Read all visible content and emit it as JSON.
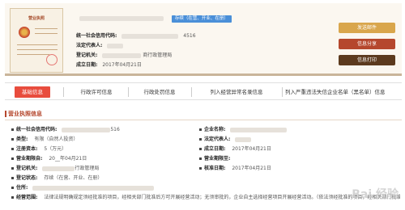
{
  "summary": {
    "cert_title": "营业执照",
    "credit_code_label": "统一社会信用代码:",
    "credit_code_value": "4516",
    "rep_label": "法定代表人:",
    "authority_label": "登记机关:",
    "authority_value": "商行政管理局",
    "established_label": "成立日期:",
    "established_value": "2017年04月21日",
    "status_badge": "存续（在营、开业、在册）",
    "actions": [
      "发送邮件",
      "信息分享",
      "信息打印"
    ]
  },
  "colors": {
    "accent_tab": "#e84c3d",
    "badge": "#4a8fd8",
    "btn_mail": "#d9a64c",
    "btn_share": "#b5472d",
    "btn_print": "#5c3a1e"
  },
  "tabs": [
    {
      "label": "基础信息",
      "active": true
    },
    {
      "label": "行政许可信息"
    },
    {
      "label": "行政处罚信息"
    },
    {
      "label": "列入经营异常名录信息"
    },
    {
      "label": "列入严重违法失信企业名单（黑名单）信息"
    }
  ],
  "section": {
    "title": "营业执照信息"
  },
  "details": {
    "credit_code": {
      "label": "统一社会信用代码:",
      "value": "516"
    },
    "company_name": {
      "label": "企业名称:"
    },
    "type": {
      "label": "类型:",
      "value": "有限（自然人投资）"
    },
    "legal_rep": {
      "label": "法定代表人:"
    },
    "capital": {
      "label": "注册资本:",
      "value": "5（万元）"
    },
    "established": {
      "label": "成立日期:",
      "value": "2017年04月21日"
    },
    "period_from": {
      "label": "营业期限自:",
      "value": "20__年04月21日"
    },
    "period_to": {
      "label": "营业期限至:"
    },
    "authority": {
      "label": "登记机关:",
      "value": "行政管理局"
    },
    "approval_date": {
      "label": "核准日期:",
      "value": "2017年04月21日"
    },
    "reg_status": {
      "label": "登记状态:",
      "value": "存续（在营、开业、在册）"
    },
    "address": {
      "label": "住所:"
    },
    "scope": {
      "label": "经营范围:",
      "value": "法律法规明确规定须经批准的项目，经相关部门批准后方可开展经营活动；无须审批的，企业自主选择经营项目开展经营活动。（依法须经批准的项目，经相关部门批准后方可开展经营活动）"
    }
  },
  "watermark": "Bai 经验"
}
